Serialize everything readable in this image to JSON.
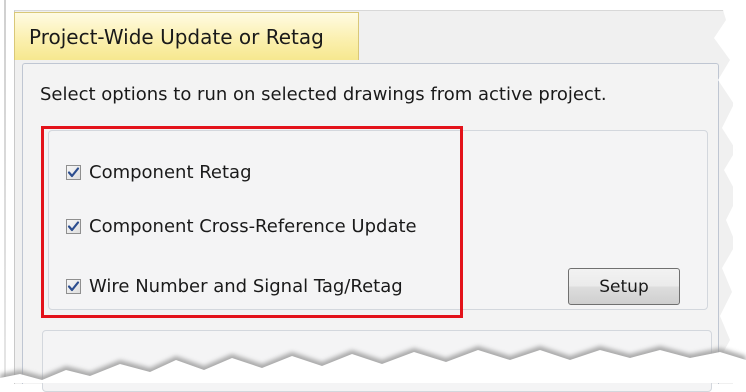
{
  "dialog": {
    "title": "Project-Wide Update or Retag",
    "instruction": "Select options to run on selected drawings from active project.",
    "options": [
      {
        "label": "Component Retag",
        "checked": true
      },
      {
        "label": "Component Cross-Reference Update",
        "checked": true
      },
      {
        "label": "Wire Number and Signal Tag/Retag",
        "checked": true
      }
    ],
    "setup_label": "Setup"
  },
  "colors": {
    "highlight": "#e3121a",
    "title_background": "#f6e88f",
    "checkmark": "#2d4e8f"
  },
  "icons": {
    "checkmark": "check-icon"
  }
}
